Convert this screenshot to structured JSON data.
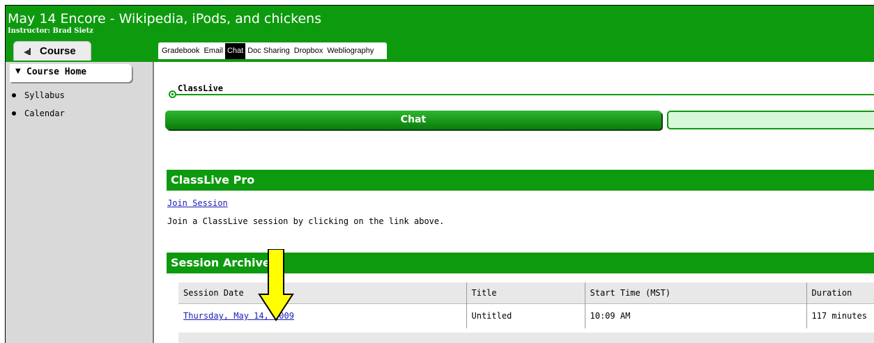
{
  "app": {
    "course_title": "May 14 Encore - Wikipedia, iPods, and chickens",
    "instructor": "Instructor: Brad Sietz"
  },
  "course_tab": {
    "label": "Course"
  },
  "tabs": [
    {
      "label": "Gradebook",
      "active": false
    },
    {
      "label": "Email",
      "active": false
    },
    {
      "label": "Chat",
      "active": true
    },
    {
      "label": "Doc Sharing",
      "active": false
    },
    {
      "label": "Dropbox",
      "active": false
    },
    {
      "label": "Webliography",
      "active": false
    }
  ],
  "sidebar": {
    "course_home": "Course Home",
    "items": [
      {
        "label": "Syllabus"
      },
      {
        "label": "Calendar"
      }
    ]
  },
  "classlive": {
    "label": "ClassLive",
    "chat_button": "Chat"
  },
  "classlive_pro": {
    "heading": "ClassLive Pro",
    "join_link": "Join Session",
    "join_description": "Join a ClassLive session by clicking on the link above."
  },
  "session_archives": {
    "heading": "Session Archives",
    "columns": [
      "Session Date",
      "Title",
      "Start Time (MST)",
      "Duration"
    ],
    "rows": [
      {
        "date": "Thursday, May 14, 2009",
        "title": "Untitled",
        "start": "10:09 AM",
        "duration": "117 minutes"
      }
    ]
  },
  "colors": {
    "brand_green": "#0e9a0e",
    "link_blue": "#1a1ab8",
    "annotation_arrow": "#ffff00"
  }
}
